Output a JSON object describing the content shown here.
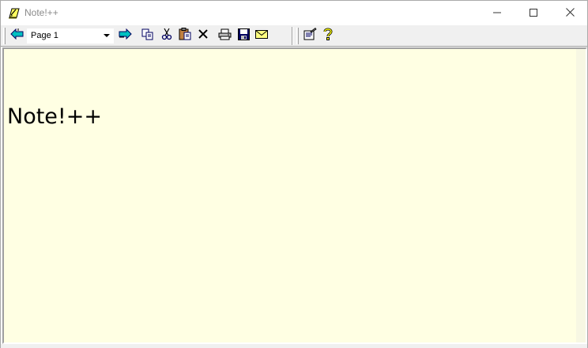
{
  "window": {
    "title": "Note!++",
    "controls": {
      "minimize": "minimize-icon",
      "maximize": "maximize-icon",
      "close": "close-icon"
    }
  },
  "toolbar": {
    "back_icon": "back-arrow-icon",
    "page_select": {
      "value": "Page 1"
    },
    "forward_icon": "forward-arrow-icon",
    "buttons": [
      "copy-icon",
      "cut-icon",
      "paste-icon",
      "delete-icon",
      "print-icon",
      "save-icon",
      "mail-icon",
      "properties-icon",
      "help-icon"
    ]
  },
  "editor": {
    "content": "Note!++",
    "background": "#ffffe3"
  },
  "colors": {
    "editor_bg": "#ffffe3",
    "toolbar_bg": "#f0f0f0",
    "title_text": "#8a8a8a"
  }
}
